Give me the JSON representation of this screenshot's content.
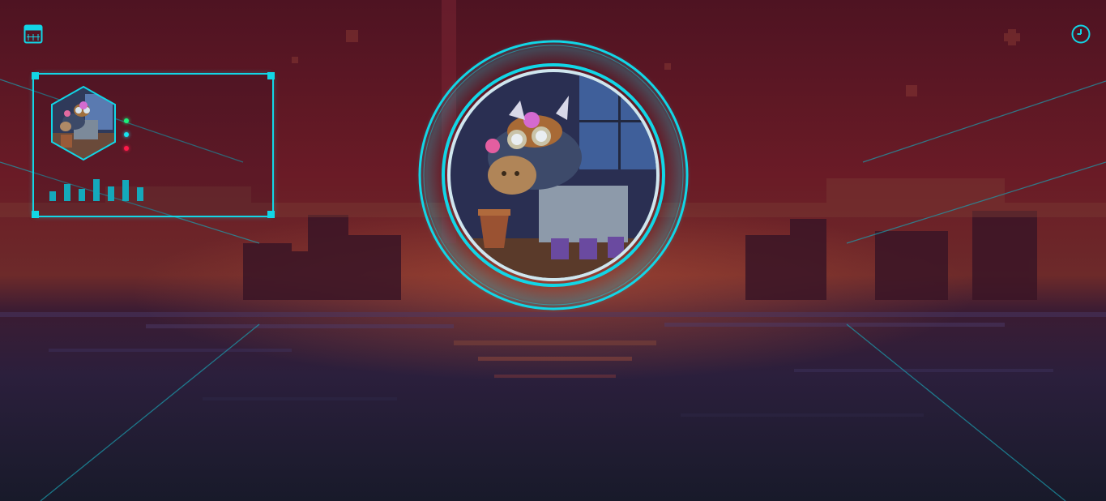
{
  "toolbar": {
    "left_icon": "calendar-icon",
    "right_icon": "clock-icon"
  },
  "profile_card": {
    "avatar": "hexagon-avatar",
    "status_dots": [
      "green",
      "cyan",
      "red"
    ],
    "equalizer_levels": [
      0.4,
      0.7,
      0.5,
      0.9,
      0.6,
      0.85,
      0.55
    ]
  },
  "portrait": {
    "subject": "steampunk-robot-cow"
  },
  "colors": {
    "accent": "#12d6e6",
    "status_green": "#1bf07a",
    "status_cyan": "#18e3f0",
    "status_red": "#ff1a4a"
  }
}
